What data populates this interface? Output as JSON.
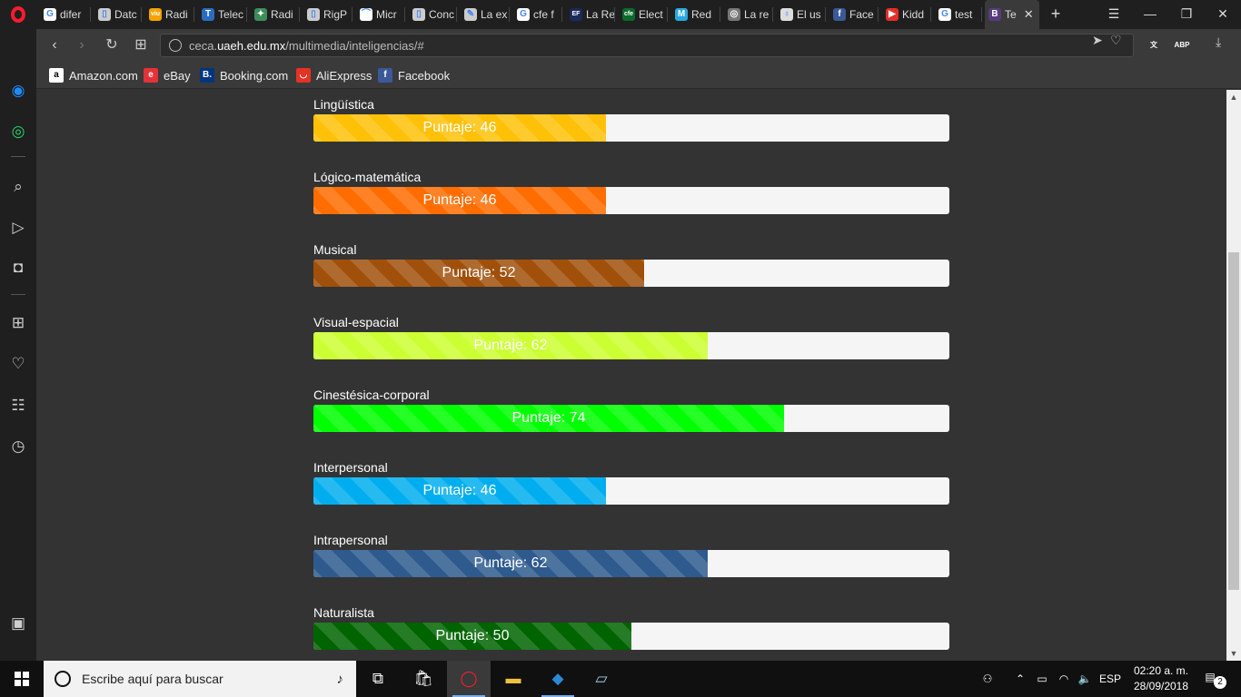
{
  "browser": {
    "tabs": [
      {
        "title": "difer",
        "favicon": "google-icon",
        "color": "#ffffff",
        "glyph": "G"
      },
      {
        "title": "Datc",
        "favicon": "document-icon",
        "color": "#cccccc",
        "glyph": "▯"
      },
      {
        "title": "Radi",
        "favicon": "viu-icon",
        "color": "#f4a300",
        "glyph": "viu"
      },
      {
        "title": "Telec",
        "favicon": "telecom-icon",
        "color": "#2a6cc0",
        "glyph": "T"
      },
      {
        "title": "Radi",
        "favicon": "radio-icon",
        "color": "#3c8c5c",
        "glyph": "✦"
      },
      {
        "title": "RigP",
        "favicon": "document-icon",
        "color": "#cccccc",
        "glyph": "▯"
      },
      {
        "title": "Micr",
        "favicon": "chart-icon",
        "color": "#ffffff",
        "glyph": "⌒"
      },
      {
        "title": "Conc",
        "favicon": "document-icon",
        "color": "#cccccc",
        "glyph": "▯"
      },
      {
        "title": "La ex",
        "favicon": "tag-icon",
        "color": "#cccccc",
        "glyph": "✎"
      },
      {
        "title": "cfe f",
        "favicon": "google-icon",
        "color": "#ffffff",
        "glyph": "G"
      },
      {
        "title": "La Re",
        "favicon": "ef-icon",
        "color": "#1a2a5a",
        "glyph": "EF"
      },
      {
        "title": "Elect",
        "favicon": "cfe-icon",
        "color": "#0a6a2a",
        "glyph": "cfe"
      },
      {
        "title": "Red",
        "favicon": "m-icon",
        "color": "#29a8e0",
        "glyph": "M"
      },
      {
        "title": "La re",
        "favicon": "globe-icon",
        "color": "#777777",
        "glyph": "◎"
      },
      {
        "title": "El us",
        "favicon": "bulb-icon",
        "color": "#dddddd",
        "glyph": "♁"
      },
      {
        "title": "Face",
        "favicon": "facebook-icon",
        "color": "#3b5998",
        "glyph": "f"
      },
      {
        "title": "Kidd",
        "favicon": "youtube-icon",
        "color": "#e52d27",
        "glyph": "▶"
      },
      {
        "title": "test",
        "favicon": "google-icon",
        "color": "#ffffff",
        "glyph": "G"
      },
      {
        "title": "Te",
        "favicon": "b-icon",
        "color": "#563d7c",
        "glyph": "B"
      }
    ],
    "url_prefix": "ceca.",
    "url_domain": "uaeh.edu.mx",
    "url_path": "/multimedia/inteligencias/#",
    "bookmarks": [
      {
        "label": "Amazon.com",
        "icon": "amazon-icon",
        "color": "#ffffff",
        "glyph": "a"
      },
      {
        "label": "eBay",
        "icon": "ebay-icon",
        "color": "#e53238",
        "glyph": "e"
      },
      {
        "label": "Booking.com",
        "icon": "booking-icon",
        "color": "#003580",
        "glyph": "B."
      },
      {
        "label": "AliExpress",
        "icon": "aliexpress-icon",
        "color": "#e43225",
        "glyph": "◡"
      },
      {
        "label": "Facebook",
        "icon": "facebook-icon",
        "color": "#3b5998",
        "glyph": "f"
      }
    ],
    "extensions": [
      {
        "name": "translate-extension-icon",
        "color": "#2a6cc0",
        "glyph": "文"
      },
      {
        "name": "adblock-plus-icon",
        "color": "#e51f23",
        "glyph": "ABP"
      }
    ]
  },
  "accent_colors": {
    "opera_red": "#ff1b2d",
    "taskbar": "#101010",
    "content_bg": "#333333"
  },
  "intelligences": [
    {
      "label": "Lingüística",
      "score_text": "Puntaje: 46",
      "score": 46,
      "color": "#ffc107"
    },
    {
      "label": "Lógico-matemática",
      "score_text": "Puntaje: 46",
      "score": 46,
      "color": "#ff6d00"
    },
    {
      "label": "Musical",
      "score_text": "Puntaje: 52",
      "score": 52,
      "color": "#a0500a"
    },
    {
      "label": "Visual-espacial",
      "score_text": "Puntaje: 62",
      "score": 62,
      "color": "#ccff33"
    },
    {
      "label": "Cinestésica-corporal",
      "score_text": "Puntaje: 74",
      "score": 74,
      "color": "#00ff00"
    },
    {
      "label": "Interpersonal",
      "score_text": "Puntaje: 46",
      "score": 46,
      "color": "#00aeef"
    },
    {
      "label": "Intrapersonal",
      "score_text": "Puntaje: 62",
      "score": 62,
      "color": "#2e5a8e"
    },
    {
      "label": "Naturalista",
      "score_text": "Puntaje: 50",
      "score": 50,
      "color": "#006400"
    }
  ],
  "taskbar": {
    "search_placeholder": "Escribe aquí para buscar",
    "language": "ESP",
    "time": "02:20 a. m.",
    "date": "28/09/2018",
    "notification_count": "2"
  }
}
